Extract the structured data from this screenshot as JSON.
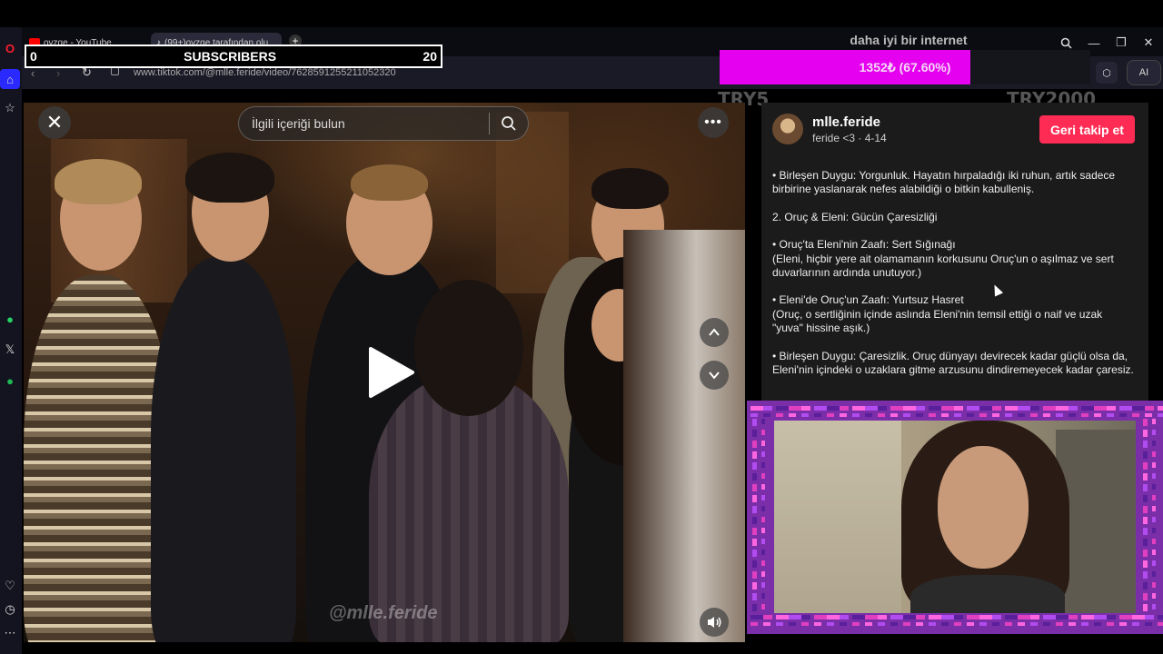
{
  "tabs": [
    {
      "label": "ovzge - YouTube",
      "favicon": "youtube-icon",
      "color": "#ff0000"
    },
    {
      "label": "(99+)ovzge tarafından olu",
      "favicon": "tiktok-icon",
      "color": "#ffffff"
    }
  ],
  "new_tab_label": "+",
  "address_url": "www.tiktok.com/@mlle.feride/video/7628591255211052320",
  "ai_label": "AI",
  "subscribers": {
    "left": "0",
    "label": "SUBSCRIBERS",
    "right": "20"
  },
  "donation": {
    "title": "daha iyi bir internet",
    "progress_text": "1352₺ (67.60%)",
    "progress": 0.676,
    "min_label": "TRY5",
    "max_label": "TRY2000",
    "fill_color": "#e600f0"
  },
  "search": {
    "placeholder": "İlgili içeriği bulun"
  },
  "video": {
    "watermark": "@mlle.feride"
  },
  "author": {
    "username": "mlle.feride",
    "subline": "feride <3 · 4-14",
    "follow_label": "Geri takip et",
    "follow_color": "#fe2c55"
  },
  "description": [
    "• Birleşen Duygu: Yorgunluk. Hayatın hırpaladığı iki ruhun, artık sadece birbirine yaslanarak nefes alabildiği o bitkin kabulleniş.",
    "",
    "2. Oruç & Eleni: Gücün Çaresizliği",
    "",
    "• Oruç'ta Eleni'nin Zaafı: Sert Sığınağı",
    "(Eleni, hiçbir yere ait olamamanın korkusunu Oruç'un o aşılmaz ve sert duvarlarının ardında unutuyor.)",
    "",
    "• Eleni'de Oruç'un Zaafı: Yurtsuz Hasret",
    "(Oruç, o sertliğinin içinde aslında Eleni'nin temsil ettiği o naif ve uzak \"yuva\" hissine aşık.)",
    "",
    "• Birleşen Duygu: Çaresizlik. Oruç dünyayı devirecek kadar güçlü olsa da, Eleni'nin içindeki o uzaklara gitme arzusunu dindiremeyecek kadar çaresiz."
  ]
}
